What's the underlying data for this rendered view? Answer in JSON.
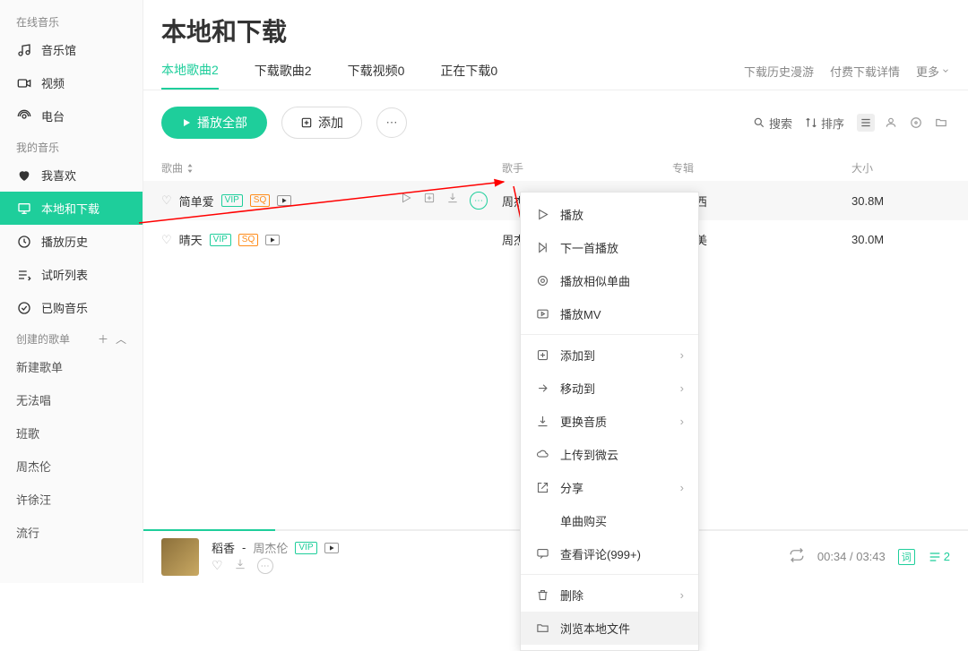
{
  "sidebar": {
    "online_label": "在线音乐",
    "online": [
      {
        "icon": "music-hall",
        "label": "音乐馆"
      },
      {
        "icon": "video",
        "label": "视频"
      },
      {
        "icon": "radio",
        "label": "电台"
      }
    ],
    "mine_label": "我的音乐",
    "mine": [
      {
        "icon": "heart",
        "label": "我喜欢"
      },
      {
        "icon": "monitor",
        "label": "本地和下载",
        "active": true
      },
      {
        "icon": "clock",
        "label": "播放历史"
      },
      {
        "icon": "playlist",
        "label": "试听列表"
      },
      {
        "icon": "purchased",
        "label": "已购音乐"
      }
    ],
    "created_label": "创建的歌单",
    "playlists": [
      "新建歌单",
      "无法唱",
      "班歌",
      "周杰伦",
      "许徐汪",
      "流行"
    ]
  },
  "header": {
    "title": "本地和下载"
  },
  "tabs": [
    {
      "label": "本地歌曲2",
      "active": true
    },
    {
      "label": "下载歌曲2"
    },
    {
      "label": "下载视频0"
    },
    {
      "label": "正在下载0"
    }
  ],
  "tabs_right": {
    "history": "下载历史漫游",
    "paid": "付费下载详情",
    "more": "更多"
  },
  "toolbar": {
    "play_all": "播放全部",
    "add": "添加",
    "search": "搜索",
    "sort": "排序"
  },
  "columns": {
    "song": "歌曲",
    "artist": "歌手",
    "album": "专辑",
    "size": "大小"
  },
  "rows": [
    {
      "name": "简单爱",
      "vip": true,
      "sq": true,
      "mv": true,
      "artist": "周杰伦",
      "album": "范特西",
      "size": "30.8M",
      "hover": true
    },
    {
      "name": "晴天",
      "vip": true,
      "sq": true,
      "mv": true,
      "artist": "周杰伦",
      "album": "叶惠美",
      "size": "30.0M"
    }
  ],
  "context": [
    {
      "icon": "play",
      "label": "播放"
    },
    {
      "icon": "next",
      "label": "下一首播放"
    },
    {
      "icon": "similar",
      "label": "播放相似单曲"
    },
    {
      "icon": "mv",
      "label": "播放MV"
    },
    {
      "sep": true
    },
    {
      "icon": "add",
      "label": "添加到",
      "sub": true
    },
    {
      "icon": "move",
      "label": "移动到",
      "sub": true
    },
    {
      "icon": "quality",
      "label": "更换音质",
      "sub": true
    },
    {
      "icon": "cloud",
      "label": "上传到微云"
    },
    {
      "icon": "share",
      "label": "分享",
      "sub": true
    },
    {
      "icon": "buy",
      "label": "单曲购买"
    },
    {
      "icon": "comment",
      "label": "查看评论(999+)"
    },
    {
      "sep": true
    },
    {
      "icon": "delete",
      "label": "删除",
      "sub": true
    },
    {
      "icon": "folder",
      "label": "浏览本地文件",
      "hl": true
    }
  ],
  "player": {
    "title": "稻香",
    "artist": "周杰伦",
    "time": "00:34 / 03:43",
    "lyric_label": "词",
    "queue_count": "2"
  }
}
